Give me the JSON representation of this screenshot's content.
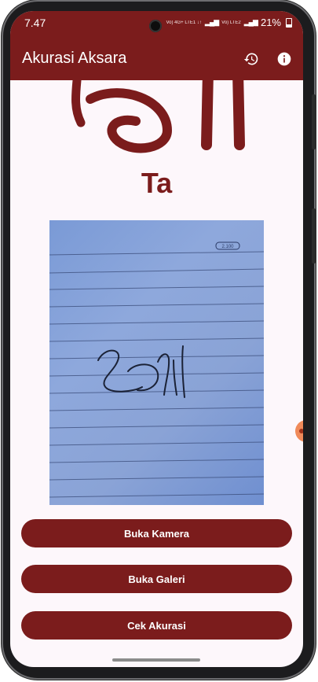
{
  "status_bar": {
    "time": "7.47",
    "network_small": "Vo) 4G+ LTE1 ↓↑",
    "network2_small": "Vo) LTE2",
    "battery": "21%"
  },
  "app_bar": {
    "title": "Akurasi Aksara",
    "history_icon": "history-icon",
    "info_icon": "info-icon"
  },
  "main": {
    "character_name": "Ta",
    "sample_image": "aksara-ta-script-sample",
    "photo": "handwritten-aksara-on-lined-paper",
    "photo_label_small": "2.100"
  },
  "actions": {
    "camera_label": "Buka Kamera",
    "gallery_label": "Buka Galeri",
    "check_label": "Cek Akurasi"
  },
  "colors": {
    "primary": "#7b1c1c",
    "background": "#fdf7fb",
    "on_primary": "#ffffff"
  }
}
